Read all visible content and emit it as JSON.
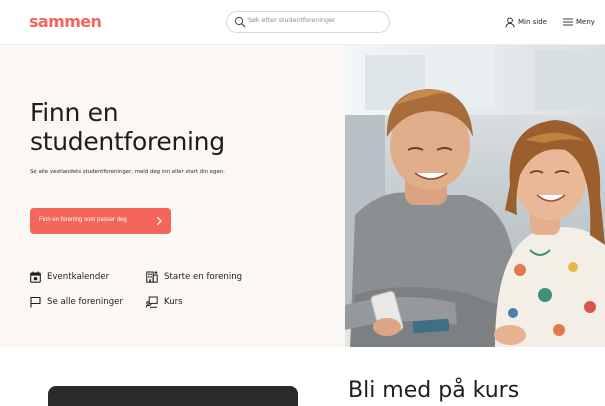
{
  "header": {
    "logo": "sammen",
    "search_placeholder": "Søk etter studentforeninger",
    "min_side_label": "Min side",
    "menu_label": "Meny"
  },
  "hero": {
    "title_line1": "Finn en",
    "title_line2": "studentforening",
    "subtitle": "Se alle vestlandets studentforeninger, meld deg inn eller start din egen.",
    "cta_label": "Finn en forening som passer deg"
  },
  "quick_links": [
    {
      "label": "Eventkalender",
      "icon": "calendar-icon"
    },
    {
      "label": "Starte en forening",
      "icon": "building-icon"
    },
    {
      "label": "Se alle foreninger",
      "icon": "flag-icon"
    },
    {
      "label": "Kurs",
      "icon": "presentation-icon"
    }
  ],
  "next_section": {
    "title": "Bli med på kurs"
  },
  "colors": {
    "brand": "#f4655b",
    "hero_background": "#fbf7f5",
    "text": "#1d1d1d"
  }
}
